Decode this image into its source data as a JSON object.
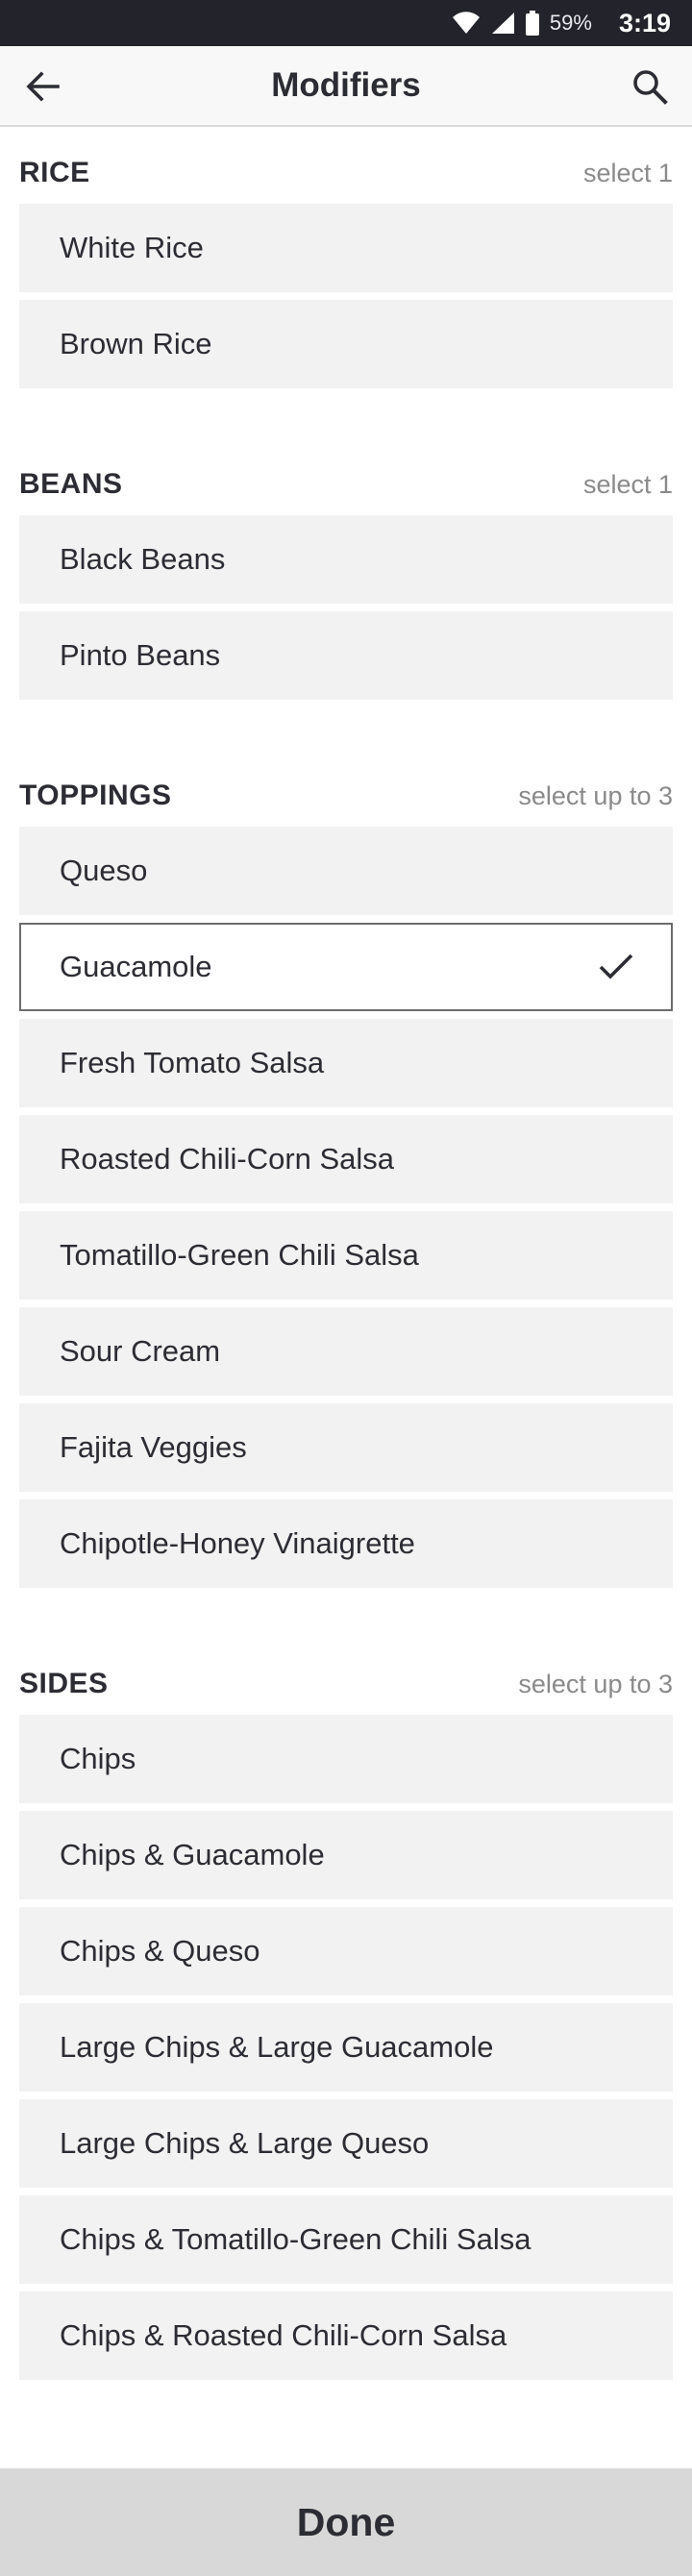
{
  "status_bar": {
    "battery_percent": "59%",
    "time": "3:19",
    "icons": [
      "wifi-icon",
      "signal-icon",
      "battery-icon"
    ]
  },
  "header": {
    "title": "Modifiers",
    "back_icon": "arrow-left-icon",
    "search_icon": "search-icon"
  },
  "sections": [
    {
      "title": "RICE",
      "rule": "select 1",
      "options": [
        {
          "label": "White Rice",
          "selected": false
        },
        {
          "label": "Brown Rice",
          "selected": false
        }
      ]
    },
    {
      "title": "BEANS",
      "rule": "select 1",
      "options": [
        {
          "label": "Black Beans",
          "selected": false
        },
        {
          "label": "Pinto Beans",
          "selected": false
        }
      ]
    },
    {
      "title": "TOPPINGS",
      "rule": "select up to 3",
      "options": [
        {
          "label": "Queso",
          "selected": false
        },
        {
          "label": "Guacamole",
          "selected": true
        },
        {
          "label": "Fresh Tomato Salsa",
          "selected": false
        },
        {
          "label": "Roasted Chili-Corn Salsa",
          "selected": false
        },
        {
          "label": "Tomatillo-Green Chili Salsa",
          "selected": false
        },
        {
          "label": "Sour Cream",
          "selected": false
        },
        {
          "label": "Fajita Veggies",
          "selected": false
        },
        {
          "label": "Chipotle-Honey Vinaigrette",
          "selected": false
        }
      ]
    },
    {
      "title": "SIDES",
      "rule": "select up to 3",
      "options": [
        {
          "label": "Chips",
          "selected": false
        },
        {
          "label": "Chips & Guacamole",
          "selected": false
        },
        {
          "label": "Chips & Queso",
          "selected": false
        },
        {
          "label": "Large Chips & Large Guacamole",
          "selected": false
        },
        {
          "label": "Large Chips & Large Queso",
          "selected": false
        },
        {
          "label": "Chips & Tomatillo-Green Chili Salsa",
          "selected": false
        },
        {
          "label": "Chips & Roasted Chili-Corn Salsa",
          "selected": false
        }
      ]
    }
  ],
  "footer": {
    "done_label": "Done"
  },
  "colors": {
    "status_bar_bg": "#22232b",
    "option_bg": "#f2f2f2",
    "selected_border": "#6c6c6c",
    "done_bg": "#d8d8d8",
    "text": "#2c2c34",
    "muted_text": "#8a8a8a"
  }
}
